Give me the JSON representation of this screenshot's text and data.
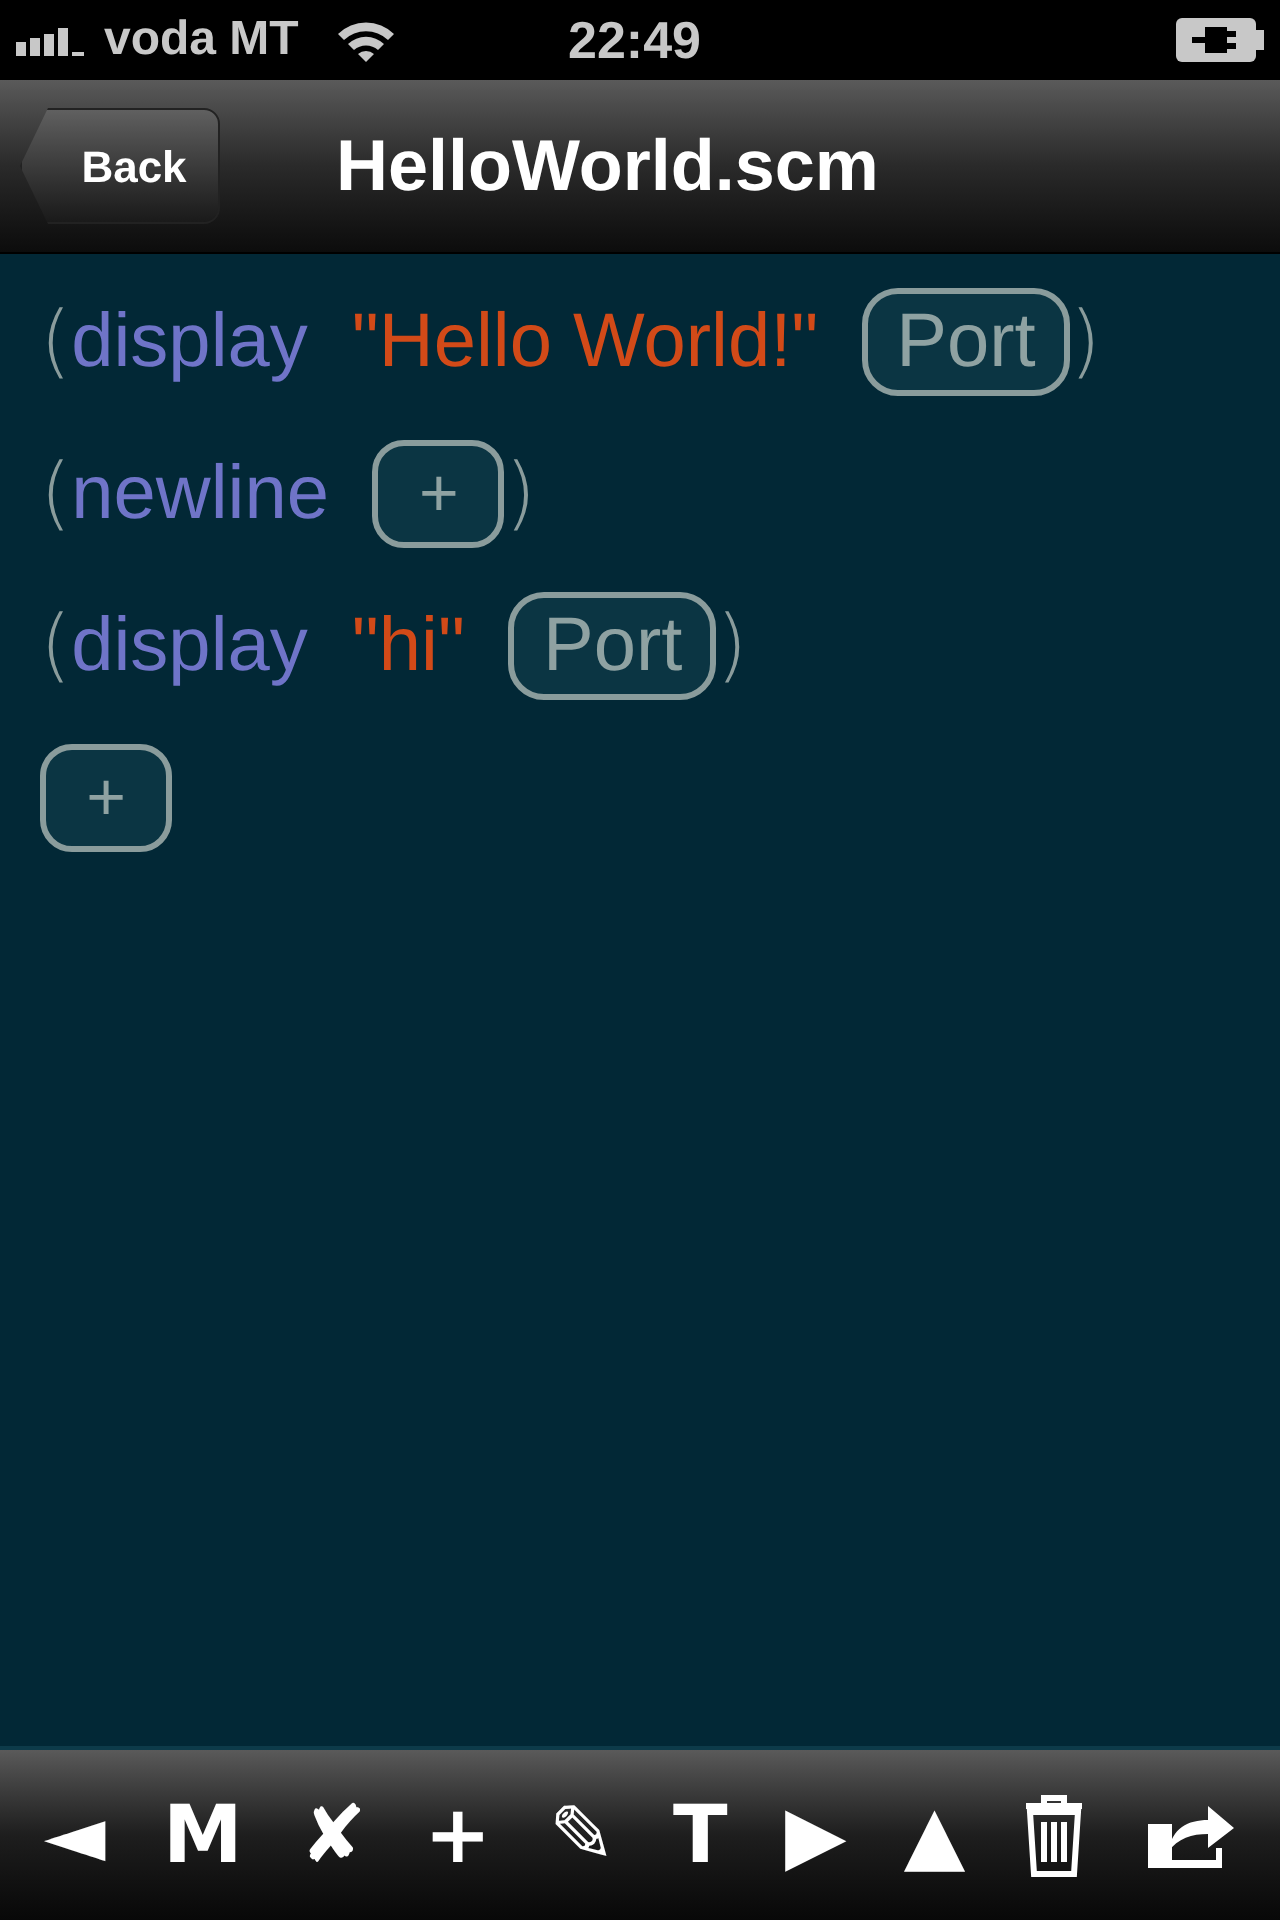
{
  "status_bar": {
    "carrier": "voda MT",
    "time": "22:49"
  },
  "nav_bar": {
    "back": "Back",
    "title": "HelloWorld.scm"
  },
  "lines": [
    {
      "tokens": [
        {
          "kind": "paren",
          "text": "("
        },
        {
          "kind": "keyword",
          "text": "display"
        },
        {
          "kind": "string",
          "text": "\"Hello World!\""
        },
        {
          "kind": "slot",
          "text": "Port"
        },
        {
          "kind": "paren",
          "text": ")"
        }
      ]
    },
    {
      "tokens": [
        {
          "kind": "paren",
          "text": "("
        },
        {
          "kind": "keyword",
          "text": "newline"
        },
        {
          "kind": "add",
          "text": "+"
        },
        {
          "kind": "paren",
          "text": ")"
        }
      ]
    },
    {
      "tokens": [
        {
          "kind": "paren",
          "text": "("
        },
        {
          "kind": "keyword",
          "text": "display"
        },
        {
          "kind": "string",
          "text": "\"hi\""
        },
        {
          "kind": "slot",
          "text": "Port"
        },
        {
          "kind": "paren",
          "text": ")"
        }
      ]
    },
    {
      "tokens": [
        {
          "kind": "add",
          "text": "+"
        }
      ]
    }
  ],
  "toolbar": [
    {
      "kind": "glyph",
      "text": "◄"
    },
    {
      "kind": "glyph",
      "text": "M"
    },
    {
      "kind": "glyph",
      "text": "✘"
    },
    {
      "kind": "glyph",
      "text": "+"
    },
    {
      "kind": "glyph",
      "text": "✎"
    },
    {
      "kind": "glyph",
      "text": "T"
    },
    {
      "kind": "glyph",
      "text": "▶"
    },
    {
      "kind": "glyph",
      "text": "▲"
    },
    {
      "kind": "trash"
    },
    {
      "kind": "share"
    }
  ]
}
